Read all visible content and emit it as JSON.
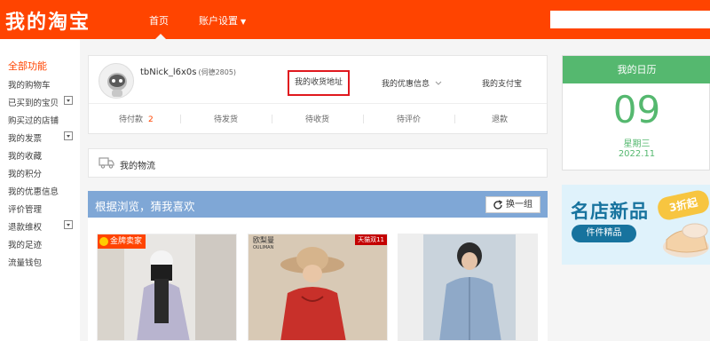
{
  "header": {
    "logo": "我的淘宝",
    "nav_home": "首页",
    "nav_settings": "账户设置",
    "search_placeholder": ""
  },
  "sidebar": {
    "title": "全部功能",
    "items": [
      {
        "label": "我的购物车",
        "dropdown": false
      },
      {
        "label": "已买到的宝贝",
        "dropdown": true
      },
      {
        "label": "购买过的店铺",
        "dropdown": false
      },
      {
        "label": "我的发票",
        "dropdown": true
      },
      {
        "label": "我的收藏",
        "dropdown": false
      },
      {
        "label": "我的积分",
        "dropdown": false
      },
      {
        "label": "我的优惠信息",
        "dropdown": false
      },
      {
        "label": "评价管理",
        "dropdown": false
      },
      {
        "label": "退款维权",
        "dropdown": true
      },
      {
        "label": "我的足迹",
        "dropdown": false
      },
      {
        "label": "流量钱包",
        "dropdown": false
      }
    ]
  },
  "profile": {
    "username": "tbNick_l6x0s",
    "id_text": "(伺德2805)",
    "address_link": "我的收货地址",
    "coupon_link": "我的优惠信息",
    "alipay_link": "我的支付宝"
  },
  "orders": [
    {
      "label": "待付款",
      "count": "2"
    },
    {
      "label": "待发货",
      "count": ""
    },
    {
      "label": "待收货",
      "count": ""
    },
    {
      "label": "待评价",
      "count": ""
    },
    {
      "label": "退款",
      "count": ""
    }
  ],
  "logistics": {
    "label": "我的物流"
  },
  "recommend": {
    "title": "根据浏览，猜我喜欢",
    "refresh_label": "换一组",
    "products": [
      {
        "badge": "金牌卖家"
      },
      {
        "brand": "欧梨曼",
        "brand_sub": "OULIMAN",
        "tag": "天猫双11"
      },
      {}
    ]
  },
  "calendar": {
    "title": "我的日历",
    "day": "09",
    "weekday": "星期三",
    "year_month": "2022.11"
  },
  "banner": {
    "title": "名店新品",
    "tag": "3折起",
    "subtitle": "件件精品"
  },
  "colors": {
    "brand": "#ff4400",
    "calendar": "#55b86f",
    "recommend_header": "#7fa7d6",
    "highlight_box": "#e0181e"
  }
}
